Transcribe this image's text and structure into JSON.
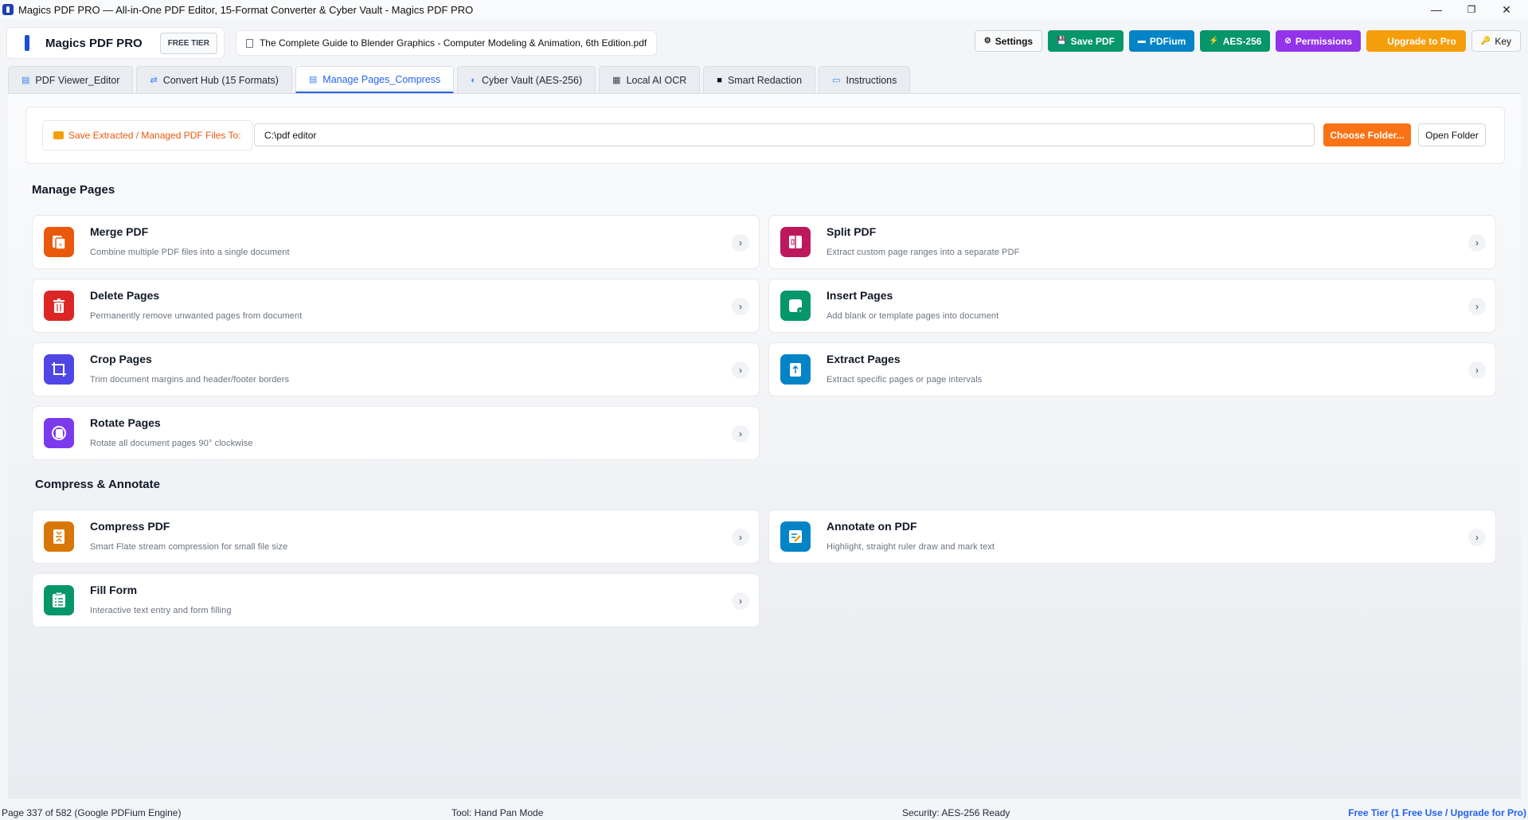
{
  "window": {
    "title": "Magics PDF PRO — All-in-One PDF Editor, 15-Format Converter & Cyber Vault - Magics PDF PRO",
    "minimize": "—",
    "restore": "❐",
    "close": "✕"
  },
  "header": {
    "app_name": "Magics PDF PRO",
    "tier_badge": "FREE TIER",
    "file_name": "The Complete Guide to Blender Graphics - Computer Modeling & Animation, 6th Edition.pdf",
    "buttons": [
      {
        "label": "Settings",
        "icon": "⚙",
        "color": "#f9fafb"
      },
      {
        "label": "Save PDF",
        "icon": "💾",
        "color": "#059669"
      },
      {
        "label": "PDFium",
        "icon": "▬",
        "color": "#0284c7"
      },
      {
        "label": "AES-256",
        "icon": "⚡",
        "color": "#059669"
      },
      {
        "label": "Permissions",
        "icon": "⊘",
        "color": "#9333ea"
      },
      {
        "label": "Upgrade to Pro",
        "icon": "",
        "color": "#f59e0b"
      },
      {
        "label": "Key",
        "icon": "🔑",
        "color": "#f9fafb"
      }
    ]
  },
  "tabs": [
    {
      "label": "PDF Viewer_Editor",
      "icon": "▤"
    },
    {
      "label": "Convert Hub (15 Formats)",
      "icon": "⇄"
    },
    {
      "label": "Manage Pages_Compress",
      "icon": "▤"
    },
    {
      "label": "Cyber Vault (AES-256)",
      "icon": "◐"
    },
    {
      "label": "Local AI OCR",
      "icon": "▦"
    },
    {
      "label": "Smart Redaction",
      "icon": "■"
    },
    {
      "label": "Instructions",
      "icon": "▭"
    }
  ],
  "active_tab": 2,
  "save_bar": {
    "label": "Save Extracted / Managed PDF Files To:",
    "path": "C:\\pdf editor",
    "choose_label": "Choose Folder...",
    "open_label": "Open Folder"
  },
  "sections": {
    "manage": "Manage Pages",
    "compress": "Compress & Annotate"
  },
  "cards": [
    {
      "title": "Merge PDF",
      "desc": "Combine multiple PDF files into a single document",
      "icon": "merge-icon",
      "color": "#ea580c"
    },
    {
      "title": "Split PDF",
      "desc": "Extract custom page ranges into a separate PDF",
      "icon": "split-icon",
      "color": "#be185d"
    },
    {
      "title": "Delete Pages",
      "desc": "Permanently remove unwanted pages from document",
      "icon": "trash-icon",
      "color": "#dc2626"
    },
    {
      "title": "Insert Pages",
      "desc": "Add blank or template pages into document",
      "icon": "insert-page-icon",
      "color": "#059669"
    },
    {
      "title": "Crop Pages",
      "desc": "Trim document margins and header/footer borders",
      "icon": "crop-icon",
      "color": "#4f46e5"
    },
    {
      "title": "Extract Pages",
      "desc": "Extract specific pages or page intervals",
      "icon": "extract-icon",
      "color": "#0284c7"
    },
    {
      "title": "Rotate Pages",
      "desc": "Rotate all document pages 90° clockwise",
      "icon": "rotate-icon",
      "color": "#7c3aed"
    },
    {
      "title": "Compress PDF",
      "desc": "Smart Flate stream compression for small file size",
      "icon": "compress-icon",
      "color": "#d97706"
    },
    {
      "title": "Annotate on PDF",
      "desc": "Highlight, straight ruler draw and mark text",
      "icon": "annotate-icon",
      "color": "#0284c7"
    },
    {
      "title": "Fill Form",
      "desc": "Interactive text entry and form filling",
      "icon": "form-icon",
      "color": "#059669"
    }
  ],
  "chevron": "›",
  "status": {
    "page": "Page 337 of 582 (Google PDFium Engine)",
    "tool": "Tool: Hand Pan Mode",
    "security": "Security: AES-256 Ready",
    "tier": "Free Tier (1 Free Use / Upgrade for Pro)"
  }
}
